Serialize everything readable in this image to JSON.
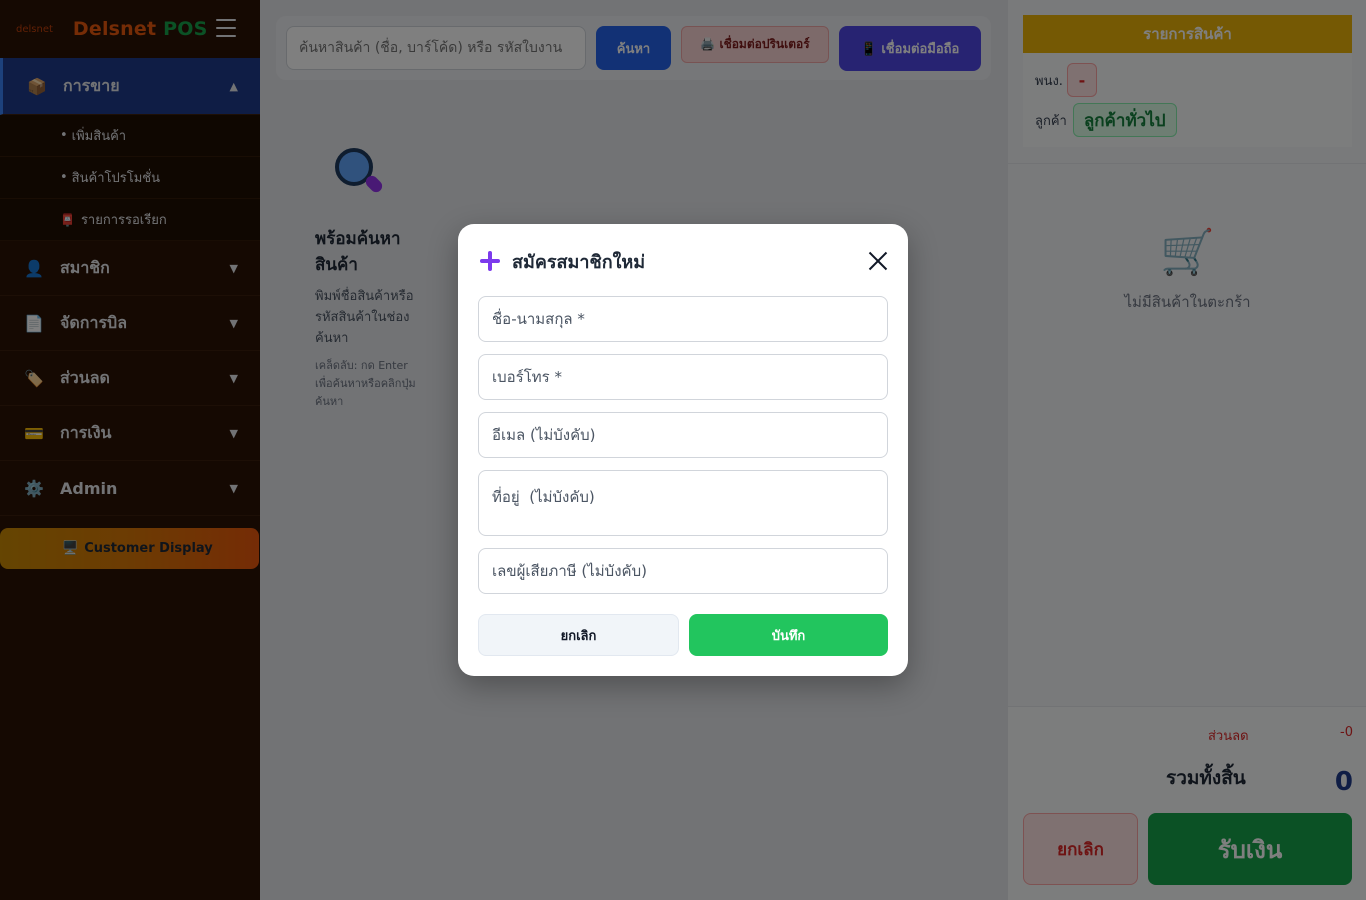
{
  "brand": {
    "small": "delsnet",
    "name": "Delsnet",
    "pos": "POS"
  },
  "sidebar": {
    "items": [
      {
        "label": "การขาย",
        "icon": "box-icon",
        "caret": "▲"
      },
      {
        "label": "สมาชิก",
        "icon": "person-icon",
        "caret": "▼"
      },
      {
        "label": "จัดการบิล",
        "icon": "document-icon",
        "caret": "▼"
      },
      {
        "label": "ส่วนลด",
        "icon": "tag-icon",
        "caret": "▼"
      },
      {
        "label": "การเงิน",
        "icon": "card-icon",
        "caret": "▼"
      },
      {
        "label": "Admin",
        "icon": "gear-icon",
        "caret": "▼"
      }
    ],
    "sub_items": [
      {
        "label": "เพิ่มสินค้า",
        "prefix": "•"
      },
      {
        "label": "สินค้าโปรโมชั่น",
        "prefix": "•"
      },
      {
        "label": "รายการรอเรียก",
        "prefix": "📮"
      }
    ],
    "customer_display": {
      "label": "Customer Display",
      "icon": "🖥️"
    }
  },
  "search": {
    "placeholder": "ค้นหาสินค้า (ชื่อ, บาร์โค้ด) หรือ รหัสใบงาน",
    "button_label": "ค้นหา",
    "printer_label": "🖨️ เชื่อมต่อปรินเตอร์",
    "mobile_label": "📱 เชื่อมต่อมือถือ"
  },
  "empty_state": {
    "title": "พร้อมค้นหาสินค้า",
    "description": "พิมพ์ชื่อสินค้าหรือรหัสสินค้าในช่องค้นหา",
    "hint": "เคล็ดลับ: กด Enter เพื่อค้นหาหรือคลิกปุ่มค้นหา"
  },
  "cart": {
    "title": "รายการสินค้า",
    "employee_label": "พนง.",
    "employee_value": "-",
    "customer_label": "ลูกค้า",
    "customer_value": "ลูกค้าทั่วไป",
    "empty_text": "ไม่มีสินค้าในตะกร้า",
    "discount_label": "ส่วนลด",
    "discount_value": "-0",
    "total_label": "รวมทั้งสิ้น",
    "total_value": "0",
    "cancel_label": "ยกเลิก",
    "pay_label": "รับเงิน"
  },
  "modal": {
    "title": "สมัครสมาชิกใหม่",
    "fields": {
      "name_placeholder": "ชื่อ-นามสกุล *",
      "phone_placeholder": "เบอร์โทร *",
      "email_placeholder": "อีเมล (ไม่บังคับ)",
      "address_placeholder": "ที่อยู่  (ไม่บังคับ)",
      "tax_placeholder": "เลขผู้เสียภาษี (ไม่บังคับ)"
    },
    "cancel_label": "ยกเลิก",
    "save_label": "บันทึก"
  },
  "colors": {
    "sidebar_bg": "#2a1305",
    "active_menu": "#1e3a8a",
    "search_button": "#2563eb",
    "mobile_button": "#4f46e5",
    "cart_header": "#eab308",
    "pay_button": "#16a34a",
    "save_button": "#22c55e",
    "modal_accent": "#7c3aed"
  }
}
